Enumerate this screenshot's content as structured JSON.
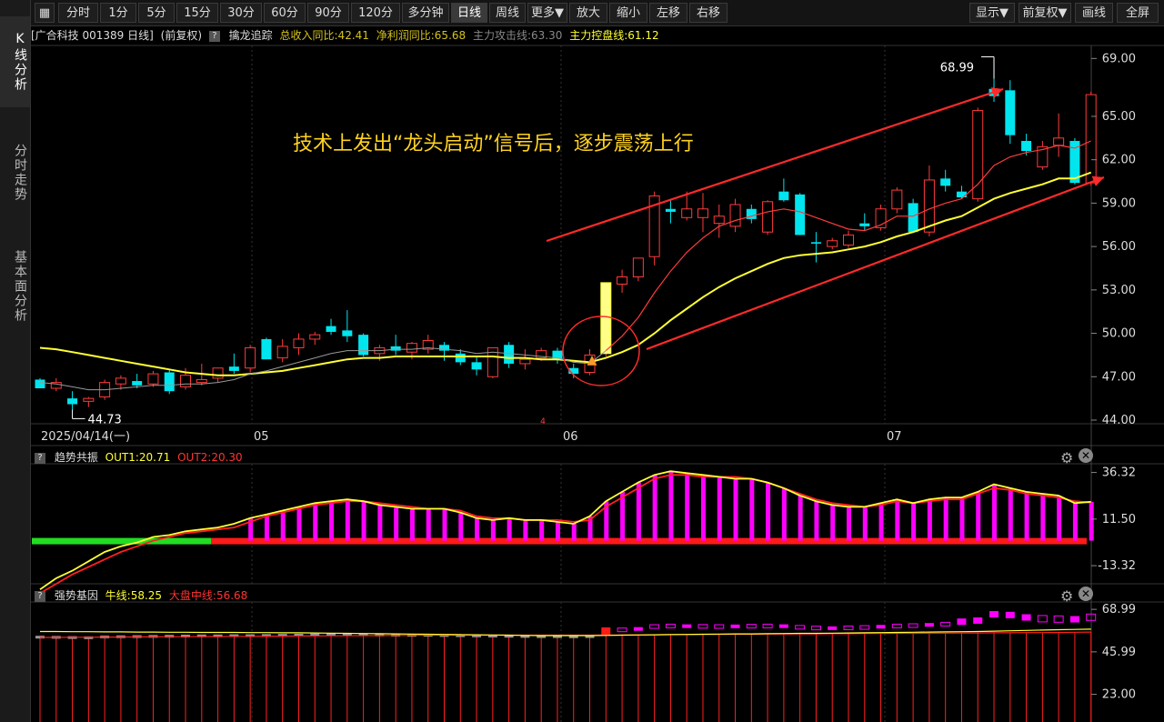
{
  "sidebar": {
    "tabs": [
      {
        "label": "K线分析",
        "active": true
      },
      {
        "label": "分时走势",
        "active": false
      },
      {
        "label": "基本面分析",
        "active": false
      }
    ]
  },
  "toolbar": {
    "left": [
      "分时",
      "1分",
      "5分",
      "15分",
      "30分",
      "60分",
      "90分",
      "120分",
      "多分钟",
      "日线",
      "周线",
      "更多▼",
      "放大",
      "缩小",
      "左移",
      "右移"
    ],
    "active": "日线",
    "right": [
      "显示▼",
      "前复权▼",
      "画线",
      "全屏"
    ]
  },
  "info": {
    "stock": "[广合科技 001389 日线]",
    "adjust": "(前复权)",
    "q": "?",
    "indicator": "擒龙追踪",
    "revenue": "总收入同比:42.41",
    "profit": "净利润同比:65.68",
    "attack": "主力攻击线:63.30",
    "control": "主力控盘线:61.12"
  },
  "colors": {
    "up": "#ff3b3b",
    "down": "#00e5ee",
    "yellow": "#ffff33",
    "magenta": "#ff00ff",
    "green": "#22dd22"
  },
  "annotation": "技术上发出“龙头启动”信号后，逐步震荡上行",
  "markers": {
    "high": "68.99",
    "low": "44.73",
    "small": "4"
  },
  "x_dates": [
    "2025/04/14(一)",
    "05",
    "06",
    "07"
  ],
  "chart_data": [
    {
      "type": "candlestick",
      "title": "",
      "ylim": [
        44,
        69.9
      ],
      "yticks": [
        69.0,
        65.0,
        62.0,
        59.0,
        56.0,
        53.0,
        50.0,
        47.0,
        44.0
      ],
      "ytick_labels": [
        "69.00",
        "65.00",
        "62.00",
        "59.00",
        "56.00",
        "53.00",
        "50.00",
        "47.00",
        "44.00"
      ],
      "ohlc": [
        [
          46.8,
          46.9,
          46.2,
          46.2
        ],
        [
          46.2,
          46.9,
          46.0,
          46.6
        ],
        [
          45.5,
          46.0,
          44.73,
          45.1
        ],
        [
          45.3,
          45.6,
          44.9,
          45.5
        ],
        [
          45.6,
          46.8,
          45.4,
          46.6
        ],
        [
          46.5,
          47.1,
          46.1,
          46.9
        ],
        [
          46.7,
          47.2,
          46.2,
          46.4
        ],
        [
          46.5,
          47.4,
          46.3,
          47.2
        ],
        [
          47.3,
          47.5,
          45.8,
          46.0
        ],
        [
          46.3,
          47.6,
          46.1,
          47.1
        ],
        [
          46.6,
          47.9,
          46.4,
          46.8
        ],
        [
          46.9,
          47.6,
          46.6,
          47.6
        ],
        [
          47.7,
          48.6,
          47.2,
          47.4
        ],
        [
          47.6,
          49.2,
          47.3,
          49.0
        ],
        [
          49.6,
          49.7,
          48.2,
          48.2
        ],
        [
          48.3,
          49.6,
          48.0,
          49.1
        ],
        [
          49.0,
          50.0,
          48.5,
          49.6
        ],
        [
          49.6,
          50.1,
          49.2,
          49.9
        ],
        [
          50.5,
          51.0,
          49.9,
          50.1
        ],
        [
          50.2,
          51.6,
          49.4,
          49.8
        ],
        [
          49.9,
          50.0,
          48.4,
          48.5
        ],
        [
          48.6,
          49.2,
          48.1,
          49.0
        ],
        [
          49.1,
          49.9,
          48.5,
          48.8
        ],
        [
          48.7,
          49.4,
          48.2,
          49.3
        ],
        [
          48.9,
          49.9,
          48.6,
          49.5
        ],
        [
          49.2,
          49.4,
          48.1,
          48.8
        ],
        [
          48.6,
          48.9,
          47.8,
          48.0
        ],
        [
          48.0,
          48.4,
          47.1,
          47.5
        ],
        [
          47.0,
          49.0,
          46.9,
          49.0
        ],
        [
          49.2,
          49.4,
          47.6,
          47.9
        ],
        [
          47.9,
          48.9,
          47.5,
          48.2
        ],
        [
          48.3,
          49.0,
          48.1,
          48.8
        ],
        [
          48.8,
          49.0,
          47.9,
          48.2
        ],
        [
          47.6,
          47.9,
          46.9,
          47.2
        ],
        [
          47.3,
          48.9,
          47.1,
          48.5
        ],
        [
          48.6,
          53.5,
          48.4,
          53.5
        ],
        [
          53.4,
          54.4,
          52.8,
          53.9
        ],
        [
          53.9,
          55.2,
          53.6,
          55.2
        ],
        [
          55.3,
          59.8,
          54.7,
          59.5
        ],
        [
          58.6,
          59.3,
          57.6,
          58.4
        ],
        [
          58.0,
          59.8,
          57.8,
          58.6
        ],
        [
          58.0,
          59.7,
          57.0,
          58.6
        ],
        [
          57.6,
          58.9,
          56.6,
          58.1
        ],
        [
          57.4,
          59.3,
          57.0,
          58.9
        ],
        [
          58.6,
          58.9,
          57.6,
          57.9
        ],
        [
          57.0,
          59.2,
          56.8,
          59.1
        ],
        [
          59.8,
          60.7,
          59.1,
          59.2
        ],
        [
          59.6,
          59.7,
          56.8,
          56.8
        ],
        [
          56.3,
          57.0,
          54.9,
          56.2
        ],
        [
          56.0,
          56.6,
          55.8,
          56.4
        ],
        [
          56.1,
          57.1,
          55.9,
          56.8
        ],
        [
          57.6,
          58.3,
          57.1,
          57.4
        ],
        [
          57.3,
          58.9,
          57.1,
          58.6
        ],
        [
          58.6,
          60.1,
          58.3,
          59.9
        ],
        [
          59.0,
          59.3,
          57.0,
          57.0
        ],
        [
          57.0,
          61.6,
          56.7,
          60.6
        ],
        [
          60.7,
          61.3,
          59.8,
          60.2
        ],
        [
          59.8,
          60.2,
          59.3,
          59.4
        ],
        [
          59.3,
          65.6,
          59.1,
          65.4
        ],
        [
          66.9,
          68.99,
          66.0,
          66.4
        ],
        [
          66.8,
          67.5,
          63.1,
          63.7
        ],
        [
          63.3,
          63.8,
          62.3,
          62.6
        ],
        [
          61.5,
          63.3,
          61.3,
          62.9
        ],
        [
          63.0,
          65.2,
          62.2,
          63.5
        ],
        [
          63.3,
          63.5,
          60.3,
          60.4
        ],
        [
          60.4,
          66.7,
          60.2,
          66.5
        ]
      ],
      "series": [
        {
          "name": "主力攻击线",
          "values": [
            46.6,
            46.5,
            46.3,
            46.1,
            46.1,
            46.2,
            46.3,
            46.4,
            46.4,
            46.5,
            46.5,
            46.6,
            46.8,
            47.2,
            47.4,
            47.7,
            48.0,
            48.3,
            48.6,
            48.8,
            48.8,
            48.8,
            48.9,
            48.9,
            49.0,
            48.9,
            48.8,
            48.6,
            48.7,
            48.6,
            48.5,
            48.4,
            48.3,
            48.0,
            47.9,
            48.8,
            49.8,
            51.1,
            52.8,
            54.3,
            55.6,
            56.6,
            57.4,
            57.8,
            58.1,
            58.4,
            58.6,
            58.4,
            58.0,
            57.6,
            57.2,
            57.1,
            57.5,
            58.1,
            58.1,
            58.6,
            59.0,
            59.3,
            60.3,
            61.6,
            62.2,
            62.5,
            62.7,
            63.0,
            62.8,
            63.3
          ]
        },
        {
          "name": "主力控盘线",
          "values": [
            49.0,
            48.9,
            48.7,
            48.5,
            48.3,
            48.1,
            47.9,
            47.7,
            47.5,
            47.3,
            47.2,
            47.1,
            47.1,
            47.2,
            47.3,
            47.4,
            47.6,
            47.8,
            48.0,
            48.2,
            48.3,
            48.3,
            48.4,
            48.4,
            48.4,
            48.4,
            48.4,
            48.4,
            48.4,
            48.3,
            48.3,
            48.2,
            48.2,
            48.1,
            48.0,
            48.3,
            48.7,
            49.2,
            50.0,
            50.9,
            51.7,
            52.5,
            53.2,
            53.8,
            54.3,
            54.8,
            55.2,
            55.4,
            55.5,
            55.6,
            55.8,
            56.0,
            56.3,
            56.7,
            57.0,
            57.4,
            57.8,
            58.1,
            58.7,
            59.3,
            59.7,
            60.0,
            60.3,
            60.7,
            60.7,
            61.12
          ]
        }
      ]
    },
    {
      "type": "bar",
      "title": "趋势共振",
      "legend": [
        "OUT1:20.71",
        "OUT2:20.30"
      ],
      "ylim": [
        -22,
        40
      ],
      "yticks": [
        36.32,
        11.5,
        -13.32
      ],
      "ytick_labels": [
        "36.32",
        "11.50",
        "-13.32"
      ],
      "series": [
        {
          "name": "OUT1",
          "values": [
            -26,
            -20,
            -16,
            -11,
            -6,
            -3,
            -1,
            2,
            3,
            5,
            6,
            7,
            9,
            12,
            14,
            16,
            18,
            20,
            21,
            22,
            21,
            19,
            18,
            17,
            17,
            17,
            15,
            12,
            11,
            12,
            11,
            11,
            10,
            9,
            13,
            21,
            26,
            31,
            35,
            37,
            36,
            35,
            34,
            33,
            33,
            31,
            28,
            24,
            21,
            19,
            18,
            18,
            20,
            22,
            20,
            22,
            23,
            23,
            26,
            30,
            28,
            26,
            25,
            24,
            20,
            20.71
          ]
        },
        {
          "name": "OUT2",
          "values": [
            -28,
            -23,
            -18,
            -14,
            -10,
            -6,
            -3,
            0,
            2,
            4,
            5,
            6,
            7,
            10,
            13,
            15,
            17,
            19,
            20,
            21,
            21,
            20,
            19,
            18,
            17,
            17,
            16,
            13,
            12,
            12,
            11,
            11,
            11,
            10,
            11,
            18,
            23,
            28,
            33,
            35,
            35,
            34,
            34,
            34,
            33,
            31,
            28,
            25,
            22,
            20,
            19,
            18,
            19,
            21,
            20,
            21,
            22,
            22,
            25,
            28,
            27,
            25,
            24,
            23,
            21,
            20.3
          ]
        }
      ]
    },
    {
      "type": "bar",
      "title": "强势基因",
      "legend": [
        "牛线:58.25",
        "大盘中线:56.68"
      ],
      "ylim": [
        10,
        72
      ],
      "yticks": [
        68.99,
        45.99,
        23.0
      ],
      "ytick_labels": [
        "68.99",
        "45.99",
        "23.00"
      ],
      "series": [
        {
          "name": "牛线",
          "values": [
            57.0,
            57.0,
            56.9,
            56.9,
            56.8,
            56.8,
            56.7,
            56.7,
            56.6,
            56.6,
            56.5,
            56.5,
            56.5,
            56.4,
            56.4,
            56.3,
            56.3,
            56.2,
            56.1,
            56.0,
            55.9,
            55.8,
            55.7,
            55.6,
            55.5,
            55.4,
            55.3,
            55.2,
            55.1,
            55.0,
            54.9,
            54.8,
            54.8,
            54.8,
            54.8,
            54.9,
            55.0,
            55.1,
            55.2,
            55.3,
            55.4,
            55.5,
            55.6,
            55.7,
            55.7,
            55.8,
            55.9,
            56.0,
            56.0,
            56.1,
            56.2,
            56.3,
            56.4,
            56.5,
            56.6,
            56.7,
            56.8,
            56.9,
            57.0,
            57.2,
            57.4,
            57.6,
            57.8,
            58.0,
            58.1,
            58.25
          ]
        },
        {
          "name": "大盘中线",
          "values": [
            53.8,
            53.8,
            53.9,
            53.9,
            54.0,
            54.0,
            54.1,
            54.1,
            54.2,
            54.2,
            54.3,
            54.3,
            54.4,
            54.4,
            54.5,
            54.5,
            54.6,
            54.6,
            54.7,
            54.7,
            54.8,
            54.8,
            54.9,
            54.9,
            55.0,
            55.0,
            55.0,
            55.0,
            55.0,
            55.0,
            55.0,
            55.0,
            55.0,
            55.0,
            55.0,
            55.1,
            55.1,
            55.2,
            55.2,
            55.3,
            55.3,
            55.4,
            55.4,
            55.5,
            55.5,
            55.6,
            55.6,
            55.7,
            55.7,
            55.8,
            55.8,
            55.9,
            55.9,
            56.0,
            56.0,
            56.1,
            56.1,
            56.2,
            56.2,
            56.3,
            56.3,
            56.4,
            56.4,
            56.5,
            56.6,
            56.68
          ]
        }
      ]
    }
  ]
}
